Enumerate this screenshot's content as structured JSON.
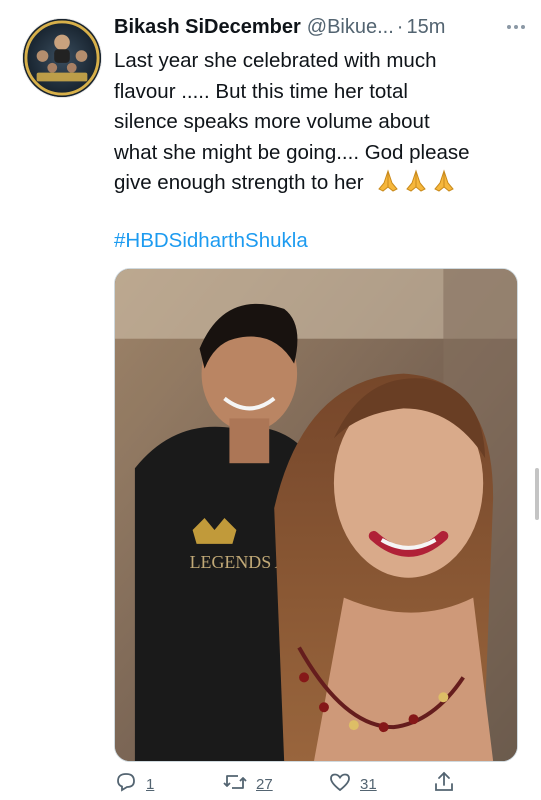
{
  "tweet": {
    "author_name": "Bikash SiDecember",
    "author_handle": "@Bikue...",
    "separator": "·",
    "timestamp": "15m",
    "text_lines": [
      "Last year she celebrated with much",
      "flavour ..... But this time her total",
      "silence speaks more volume about",
      "what she might be going.... God please",
      "give enough strength to her"
    ],
    "emoji": "folded-hands x3",
    "hashtag": "#HBDSidharthShukla",
    "shirt_print": "LEGENDS ARE BORN IN DECEMBER",
    "stats": {
      "replies": "1",
      "retweets": "27",
      "likes": "31"
    }
  },
  "icons": {
    "more": "more-options-icon",
    "reply": "reply-icon",
    "retweet": "retweet-icon",
    "like": "like-icon",
    "share": "share-icon"
  },
  "colors": {
    "text": "#0f1419",
    "secondary": "#536471",
    "link": "#1d9bf0",
    "border": "#cfd9de"
  }
}
